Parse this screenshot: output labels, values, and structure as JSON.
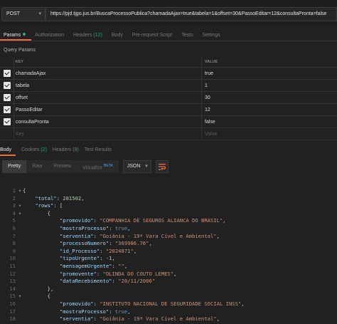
{
  "request": {
    "method": "POST",
    "url": "https://pjd.tjgo.jus.br/BuscaProcessoPublica?chamadaAjax=true&tabela=1&offset=30&PassoEditar=12&consultaPronta=false"
  },
  "request_tabs": [
    {
      "label": "Params",
      "count": "",
      "active": true,
      "dot": true
    },
    {
      "label": "Authorization",
      "count": "",
      "active": false
    },
    {
      "label": "Headers",
      "count": "(12)",
      "active": false
    },
    {
      "label": "Body",
      "count": "",
      "active": false
    },
    {
      "label": "Pre-request Script",
      "count": "",
      "active": false
    },
    {
      "label": "Tests",
      "count": "",
      "active": false
    },
    {
      "label": "Settings",
      "count": "",
      "active": false
    }
  ],
  "query_params": {
    "title": "Query Params",
    "key_header": "KEY",
    "value_header": "VALUE",
    "rows": [
      {
        "key": "chamadaAjax",
        "value": "true"
      },
      {
        "key": "tabela",
        "value": "1"
      },
      {
        "key": "offset",
        "value": "30"
      },
      {
        "key": "PassoEditar",
        "value": "12"
      },
      {
        "key": "consultaPronta",
        "value": "false"
      }
    ],
    "key_placeholder": "Key",
    "value_placeholder": "Value"
  },
  "response_tabs": [
    {
      "label": "Body",
      "count": "",
      "active": true
    },
    {
      "label": "Cookies",
      "count": "(2)",
      "active": false
    },
    {
      "label": "Headers",
      "count": "(9)",
      "active": false
    },
    {
      "label": "Test Results",
      "count": "",
      "active": false
    }
  ],
  "response_toolbar": {
    "modes": [
      "Pretty",
      "Raw",
      "Preview",
      "Visualize"
    ],
    "beta": "BETA",
    "format": "JSON"
  },
  "code_lines": [
    "{",
    "    \"total\": 281502,",
    "    \"rows\": [",
    "        {",
    "            \"promovido\": \"COMPANHIA DE SEGUROS ALIANCA DO BRASIL\",",
    "            \"mostraProcesso\": true,",
    "            \"serventia\": \"Goiânia - 19ª Vara Cível e Ambiental\",",
    "            \"processoNumero\": \"369986.76\",",
    "            \"id_Processo\": \"2024871\",",
    "            \"tipoUrgente\": -1,",
    "            \"mensagemUrgente\": \"\",",
    "            \"promovente\": \"OLINDA DO COUTO LEMES\",",
    "            \"dataRecebimento\": \"20/11/2006\"",
    "        },",
    "        {",
    "            \"promovido\": \"INSTITUTO NACIONAL DE SEGURIDADE SOCIAL INSS\",",
    "            \"mostraProcesso\": true,",
    "            \"serventia\": \"Goiânia - 19ª Vara Cível e Ambiental\",",
    "            \"processoNumero\": \"37"
  ]
}
